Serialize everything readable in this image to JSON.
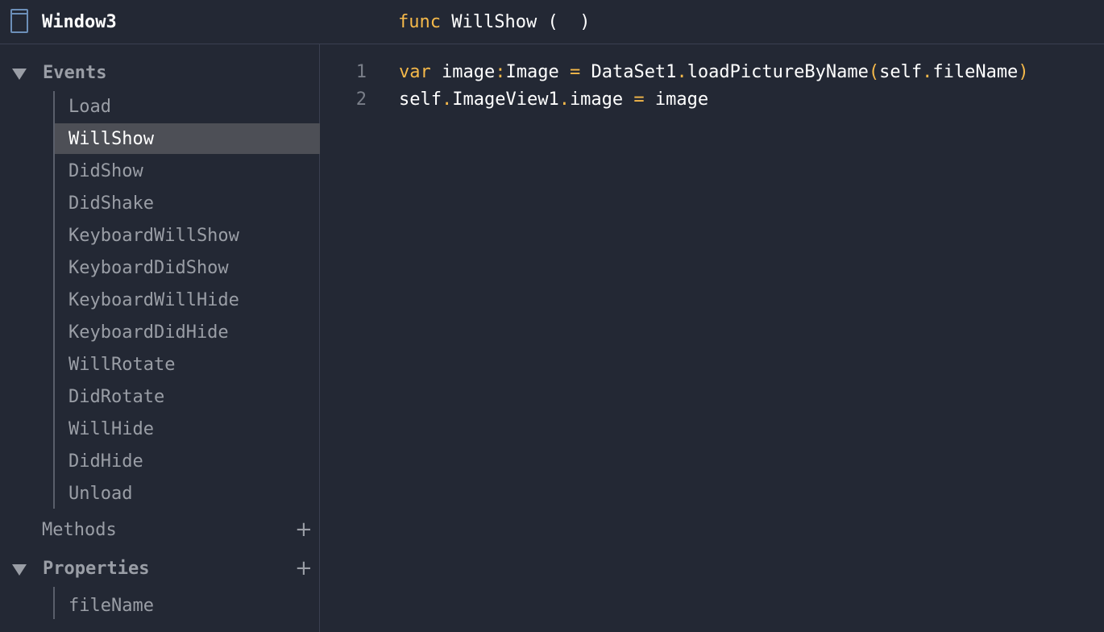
{
  "header": {
    "window_title": "Window3",
    "func_keyword": "func",
    "func_name": "WillShow",
    "func_open_paren": "(",
    "func_close_paren": ")"
  },
  "sidebar": {
    "events_label": "Events",
    "events": [
      {
        "label": "Load",
        "selected": false
      },
      {
        "label": "WillShow",
        "selected": true
      },
      {
        "label": "DidShow",
        "selected": false
      },
      {
        "label": "DidShake",
        "selected": false
      },
      {
        "label": "KeyboardWillShow",
        "selected": false
      },
      {
        "label": "KeyboardDidShow",
        "selected": false
      },
      {
        "label": "KeyboardWillHide",
        "selected": false
      },
      {
        "label": "KeyboardDidHide",
        "selected": false
      },
      {
        "label": "WillRotate",
        "selected": false
      },
      {
        "label": "DidRotate",
        "selected": false
      },
      {
        "label": "WillHide",
        "selected": false
      },
      {
        "label": "DidHide",
        "selected": false
      },
      {
        "label": "Unload",
        "selected": false
      }
    ],
    "methods_label": "Methods",
    "methods_add": "+",
    "properties_label": "Properties",
    "properties_add": "+",
    "properties": [
      {
        "label": "fileName"
      }
    ]
  },
  "editor": {
    "lines": [
      {
        "number": "1",
        "tokens": [
          {
            "t": "var",
            "c": "kw"
          },
          {
            "t": " image",
            "c": "plain"
          },
          {
            "t": ":",
            "c": "punc"
          },
          {
            "t": "Image ",
            "c": "plain"
          },
          {
            "t": "=",
            "c": "punc"
          },
          {
            "t": " DataSet1",
            "c": "plain"
          },
          {
            "t": ".",
            "c": "punc"
          },
          {
            "t": "loadPictureByName",
            "c": "plain"
          },
          {
            "t": "(",
            "c": "punc"
          },
          {
            "t": "self",
            "c": "plain"
          },
          {
            "t": ".",
            "c": "punc"
          },
          {
            "t": "fileName",
            "c": "plain"
          },
          {
            "t": ")",
            "c": "punc"
          }
        ]
      },
      {
        "number": "2",
        "tokens": [
          {
            "t": "self",
            "c": "plain"
          },
          {
            "t": ".",
            "c": "punc"
          },
          {
            "t": "ImageView1",
            "c": "plain"
          },
          {
            "t": ".",
            "c": "punc"
          },
          {
            "t": "image ",
            "c": "plain"
          },
          {
            "t": "=",
            "c": "punc"
          },
          {
            "t": " image",
            "c": "plain"
          }
        ]
      }
    ]
  },
  "colors": {
    "background": "#232834",
    "keyword": "#f5b94a",
    "selected_row": "#4d4f56",
    "muted_text": "#9a9ea6",
    "icon_blue": "#6c8fb8"
  }
}
